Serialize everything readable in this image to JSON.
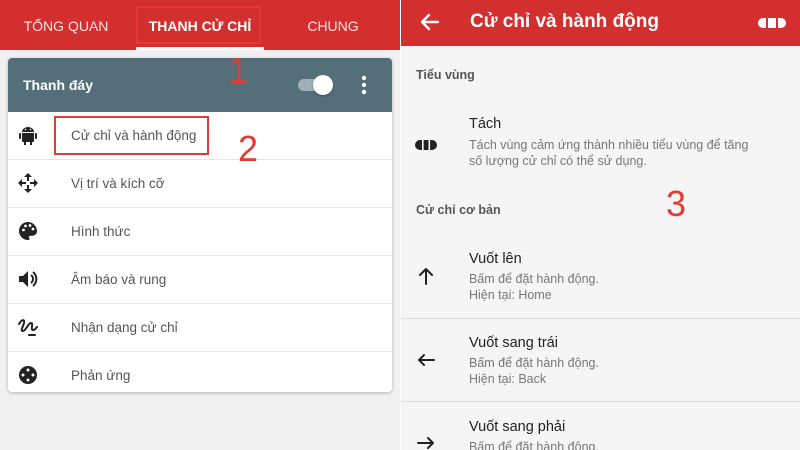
{
  "tabs": [
    {
      "label": "TỔNG QUAN"
    },
    {
      "label": "THANH CỬ CHỈ"
    },
    {
      "label": "CHUNG"
    }
  ],
  "card": {
    "title": "Thanh đáy",
    "toggle_on": true,
    "more_icon": "more-vert-icon",
    "items": [
      {
        "label": "Cử chỉ và hành động",
        "icon": "android-icon"
      },
      {
        "label": "Vị trí và kích cỡ",
        "icon": "move-arrows-icon"
      },
      {
        "label": "Hình thức",
        "icon": "palette-icon"
      },
      {
        "label": "Âm báo và rung",
        "icon": "volume-icon"
      },
      {
        "label": "Nhận dạng cử chỉ",
        "icon": "gesture-icon"
      },
      {
        "label": "Phản ứng",
        "icon": "reaction-icon"
      }
    ]
  },
  "right": {
    "title": "Cử chỉ và hành động",
    "section1": "Tiểu vùng",
    "split": {
      "title": "Tách",
      "desc_line1": "Tách vùng cảm ứng thành nhiều tiểu vùng để tăng",
      "desc_line2": "số lượng cử chỉ có thể sử dụng."
    },
    "section2": "Cử chỉ cơ bản",
    "gestures": [
      {
        "title": "Vuốt lên",
        "hint": "Bấm để đặt hành động.",
        "current": "Hiện tại: Home",
        "icon": "arrow-up-icon"
      },
      {
        "title": "Vuốt sang trái",
        "hint": "Bấm để đặt hành động.",
        "current": "Hiện tại: Back",
        "icon": "arrow-left-icon"
      },
      {
        "title": "Vuốt sang phải",
        "hint": "Bấm để đặt hành động.",
        "icon": "arrow-right-icon"
      }
    ]
  },
  "annotations": {
    "n1": "1",
    "n2": "2",
    "n3": "3"
  },
  "colors": {
    "accent": "#d32f2f",
    "card_header": "#546e7a",
    "annotation": "#e53935"
  }
}
